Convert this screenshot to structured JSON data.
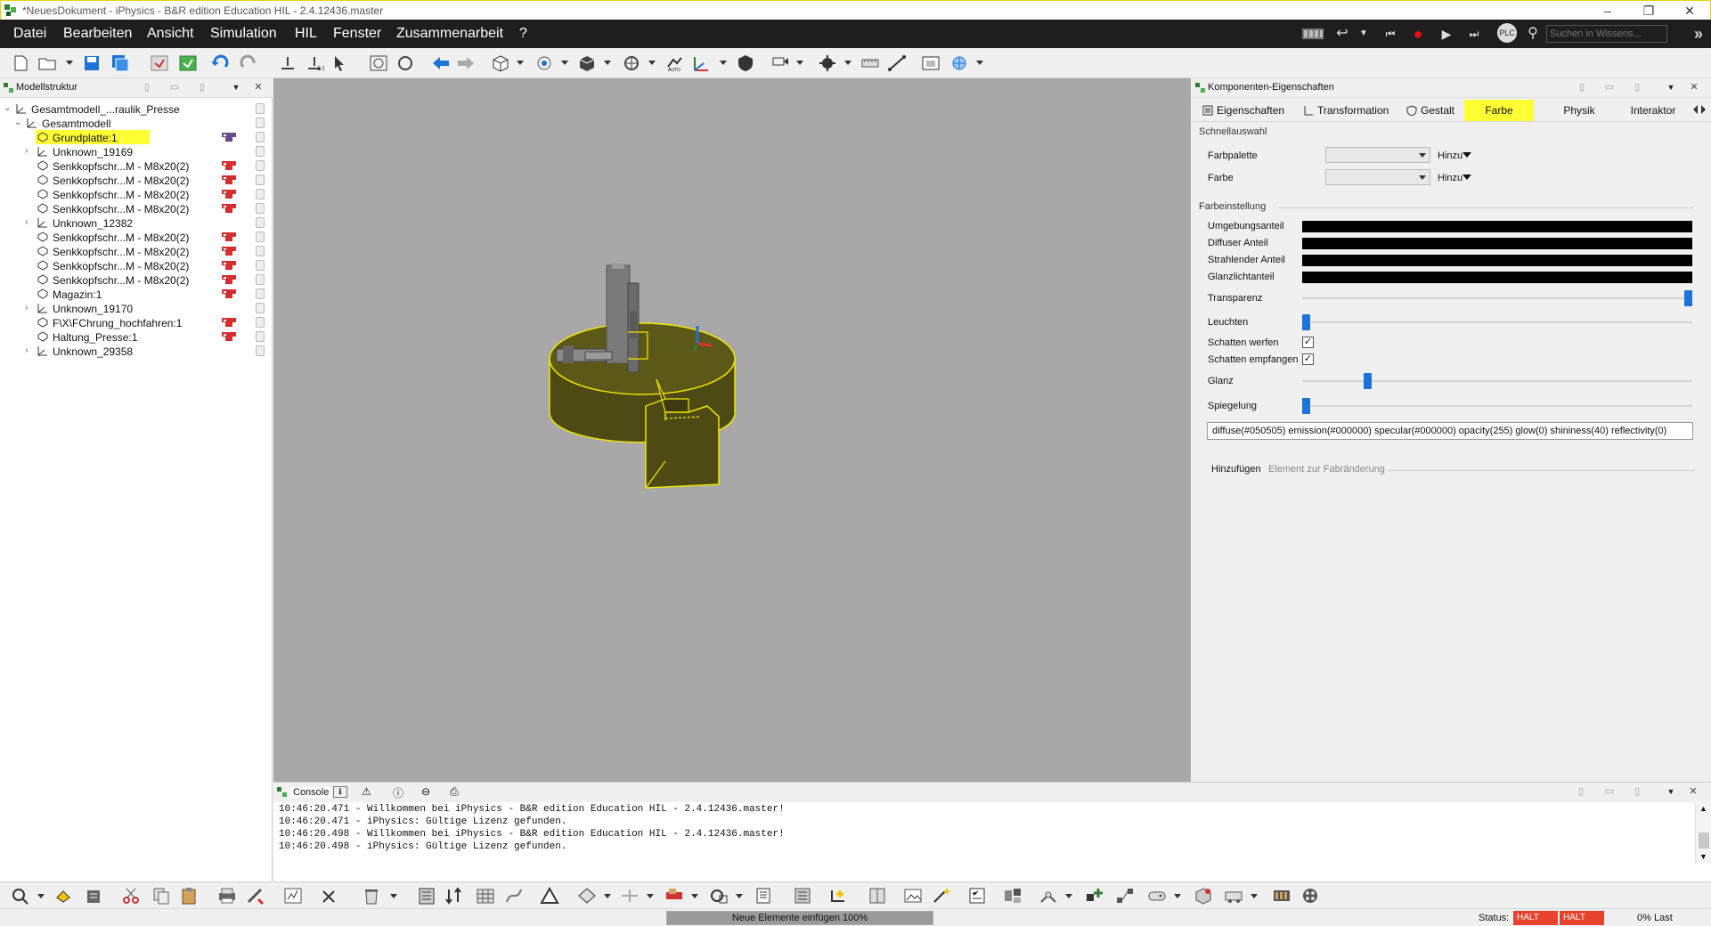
{
  "window": {
    "title": "*NeuesDokument - iPhysics - B&R edition Education HIL - 2.4.12436.master",
    "minimize": "–",
    "restore": "❐",
    "close": "✕"
  },
  "menu": {
    "items": [
      "Datei",
      "Bearbeiten",
      "Ansicht",
      "Simulation",
      "HIL",
      "Fenster",
      "Zusammenarbeit",
      "?"
    ],
    "search_placeholder": "Suchen in Wissens...",
    "plc_label": "PLC",
    "expand_label": "»"
  },
  "model_tree": {
    "title": "Modellstruktur",
    "rows": [
      {
        "label": "Gesamtmodell_...raulik_Presse",
        "indent": 0,
        "expand": "v",
        "icon": "group-icon",
        "status": false
      },
      {
        "label": "Gesamtmodell",
        "indent": 1,
        "expand": "v",
        "icon": "group-icon",
        "status": false
      },
      {
        "label": "Grundplatte:1",
        "indent": 2,
        "expand": "",
        "icon": "part-icon",
        "status": "purple",
        "highlight": true
      },
      {
        "label": "Unknown_19169",
        "indent": 2,
        "expand": ">",
        "icon": "group-icon",
        "status": false
      },
      {
        "label": "Senkkopfschr...M - M8x20(2)",
        "indent": 2,
        "expand": "",
        "icon": "part-icon",
        "status": "red"
      },
      {
        "label": "Senkkopfschr...M - M8x20(2)",
        "indent": 2,
        "expand": "",
        "icon": "part-icon",
        "status": "red"
      },
      {
        "label": "Senkkopfschr...M - M8x20(2)",
        "indent": 2,
        "expand": "",
        "icon": "part-icon",
        "status": "red"
      },
      {
        "label": "Senkkopfschr...M - M8x20(2)",
        "indent": 2,
        "expand": "",
        "icon": "part-icon",
        "status": "red"
      },
      {
        "label": "Unknown_12382",
        "indent": 2,
        "expand": ">",
        "icon": "group-icon",
        "status": false
      },
      {
        "label": "Senkkopfschr...M - M8x20(2)",
        "indent": 2,
        "expand": "",
        "icon": "part-icon",
        "status": "red"
      },
      {
        "label": "Senkkopfschr...M - M8x20(2)",
        "indent": 2,
        "expand": "",
        "icon": "part-icon",
        "status": "red"
      },
      {
        "label": "Senkkopfschr...M - M8x20(2)",
        "indent": 2,
        "expand": "",
        "icon": "part-icon",
        "status": "red"
      },
      {
        "label": "Senkkopfschr...M - M8x20(2)",
        "indent": 2,
        "expand": "",
        "icon": "part-icon",
        "status": "red"
      },
      {
        "label": "Magazin:1",
        "indent": 2,
        "expand": "",
        "icon": "part-icon",
        "status": "red"
      },
      {
        "label": "Unknown_19170",
        "indent": 2,
        "expand": ">",
        "icon": "group-icon",
        "status": false
      },
      {
        "label": "F\\X\\FChrung_hochfahren:1",
        "indent": 2,
        "expand": "",
        "icon": "part-icon",
        "status": "red"
      },
      {
        "label": "Haltung_Presse:1",
        "indent": 2,
        "expand": "",
        "icon": "part-icon",
        "status": "red"
      },
      {
        "label": "Unknown_29358",
        "indent": 2,
        "expand": ">",
        "icon": "group-icon",
        "status": false
      }
    ]
  },
  "properties": {
    "title": "Komponenten-Eigenschaften",
    "tabs": [
      {
        "label": "Eigenschaften",
        "icon": "list-icon",
        "active": false
      },
      {
        "label": "Transformation",
        "icon": "axis-icon",
        "active": false
      },
      {
        "label": "Gestalt",
        "icon": "shield-icon",
        "active": false
      },
      {
        "label": "Farbe",
        "icon": "",
        "active": true
      },
      {
        "label": "Physik",
        "icon": "",
        "active": false
      },
      {
        "label": "Interaktor",
        "icon": "",
        "active": false
      }
    ],
    "quick_section": "Schnellauswahl",
    "palette_label": "Farbpalette",
    "color_label": "Farbe",
    "add_label": "Hinzu",
    "color_section": "Farbeinstellung",
    "ambient_label": "Umgebungsanteil",
    "diffuse_label": "Diffuser Anteil",
    "emission_label": "Strahlender Anteil",
    "specular_label": "Glanzlichtanteil",
    "transparency_label": "Transparenz",
    "transparency_value": 1.0,
    "glow_label": "Leuchten",
    "glow_value": 0.0,
    "cast_shadow_label": "Schatten werfen",
    "cast_shadow_checked": true,
    "receive_shadow_label": "Schatten empfangen",
    "receive_shadow_checked": true,
    "shininess_label": "Glanz",
    "shininess_value": 0.16,
    "reflectivity_label": "Spiegelung",
    "reflectivity_value": 0.0,
    "material_string": "diffuse(#050505)  emission(#000000)  specular(#000000)  opacity(255)  glow(0)  shininess(40)  reflectivity(0)",
    "add_element_label": "Hinzufügen",
    "add_element_hint": "Element zur Fabränderung"
  },
  "console": {
    "tab_label": "Console",
    "lines": [
      "10:46:20.471 - Willkommen bei iPhysics - B&R edition Education HIL - 2.4.12436.master!",
      "10:46:20.471 - iPhysics: Gültige Lizenz gefunden.",
      "10:46:20.498 - Willkommen bei iPhysics - B&R edition Education HIL - 2.4.12436.master!",
      "10:46:20.498 - iPhysics: Gültige Lizenz gefunden."
    ]
  },
  "statusbar": {
    "progress_text": "Neue Elemente einfügen 100%",
    "progress_value": 1.0,
    "status_label": "Status:",
    "halt_1": "HALT",
    "halt_2": "HALT",
    "load": "0% Last"
  },
  "colors": {
    "accent_blue": "#1c73d8",
    "highlight_yellow": "#ffff33",
    "object_fill": "#4d4a14",
    "object_edge": "#f2e600",
    "halt_red": "#e8412c"
  }
}
